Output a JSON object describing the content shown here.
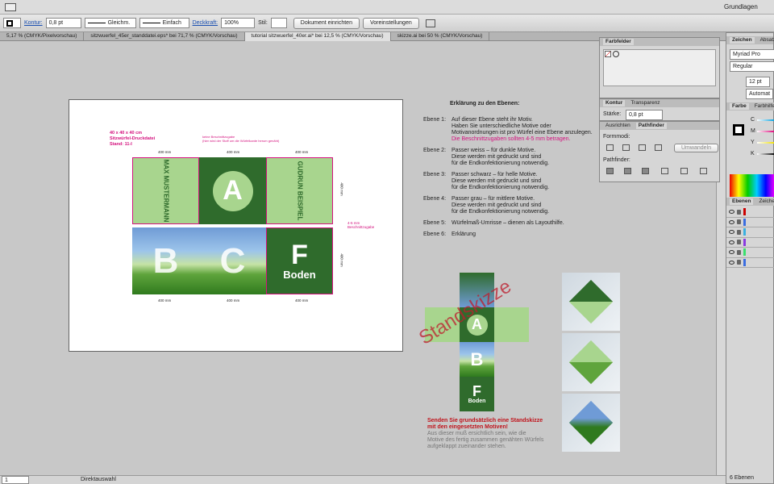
{
  "app": {
    "workspace": "Grundlagen"
  },
  "control": {
    "kontur_label": "Kontur:",
    "kontur_value": "0,8 pt",
    "stroke_style": "Gleichm.",
    "profile": "Einfach",
    "deckkraft_label": "Deckkraft:",
    "deckkraft_value": "100%",
    "stil_label": "Stil:",
    "doc_button": "Dokument einrichten",
    "prefs_button": "Voreinstellungen"
  },
  "tabs": [
    {
      "label": "5,17 % (CMYK/Pixelvorschau)"
    },
    {
      "label": "sitzwuerfel_45er_standdatei.eps* bei 71,7 % (CMYK/Vorschau)"
    },
    {
      "label": "tutorial sitzwuerfel_40er.ai* bei 12,5 % (CMYK/Vorschau)"
    },
    {
      "label": "skizze.ai bei 50 % (CMYK/Vorschau)"
    }
  ],
  "artwork": {
    "info1": "40 x 40 x 40 cm",
    "info2": "Sitzwürfel-Druckdatei",
    "info3": "Stand: 11-I",
    "note_top": "keine Beschnittzugabe",
    "note_top2": "(hier wird der Stoff um die Würfelkante herum genäht)",
    "note_right": "4-5 mm Beschnittzugabe",
    "dim": "400 mm",
    "dim_v": "400 mm",
    "name1": "MAX MUSTERMANN",
    "name2": "GUDRUN BEISPIEL",
    "letter_a": "A",
    "letter_b": "B",
    "letter_c": "C",
    "letter_f": "F",
    "boden": "Boden"
  },
  "explain": {
    "title": "Erklärung zu den Ebenen:",
    "e1_label": "Ebene 1:",
    "e1_l1": "Auf dieser Ebene steht ihr Motiv.",
    "e1_l2": "Haben Sie unterschiedliche Motive oder",
    "e1_l3": "Motivanordnungen ist pro Würfel eine Ebene anzulegen.",
    "e1_l4": "Die Beschnittzugaben sollten 4-5 mm betragen.",
    "e2_label": "Ebene 2:",
    "e2_l1": "Passer weiss – für dunkle Motive.",
    "e2_l2": "Diese werden mit gedruckt und sind",
    "e2_l3": "für die Endkonfektionierung notwendig.",
    "e3_label": "Ebene 3:",
    "e3_l1": "Passer schwarz – für helle Motive.",
    "e3_l2": "Diese werden mit gedruckt und sind",
    "e3_l3": "für die Endkonfektionierung notwendig.",
    "e4_label": "Ebene 4:",
    "e4_l1": "Passer grau – für mittlere Motive.",
    "e4_l2": "Diese werden mit gedruckt und sind",
    "e4_l3": "für die Endkonfektionierung notwendig.",
    "e5_label": "Ebene 5:",
    "e5_l1": "Würfelmaß-Umrisse – dienen als Layouthilfe.",
    "e6_label": "Ebene 6:",
    "e6_l1": "Erklärung"
  },
  "sketch": {
    "watermark": "Standskizze",
    "red1": "Senden Sie grundsätzlich eine Standskizze",
    "red2": "mit den eingesetzten Motiven!",
    "grey1": "Aus dieser muß ersichtlich sein, wie die",
    "grey2": "Motive des fertig zusammen genähten Würfels",
    "grey3": "aufgeklappt zueinander stehen."
  },
  "panels": {
    "farbfelder": "Farbfelder",
    "kontur_tab": "Kontur",
    "transparenz_tab": "Transparenz",
    "staerke_label": "Stärke:",
    "staerke_value": "0,8 pt",
    "ausrichten_tab": "Ausrichten",
    "pathfinder_tab": "Pathfinder",
    "formmodi": "Formmodi:",
    "pathfinder_label": "Pathfinder:",
    "umwandeln": "Umwandeln",
    "zeichen_tab": "Zeichen",
    "absatz_tab": "Absatz",
    "font": "Myriad Pro",
    "style": "Regular",
    "size": "12 pt",
    "leading": "Automat",
    "farbe_tab": "Farbe",
    "farbhilfe_tab": "Farbhilfe",
    "c": "C",
    "m": "M",
    "y": "Y",
    "k": "K",
    "ebenen_tab": "Ebenen",
    "zeichenflaechen_tab": "Zeichenf",
    "ebenen_count": "6 Ebenen"
  },
  "status": {
    "zoom": "1",
    "tool": "Direktauswahl"
  }
}
